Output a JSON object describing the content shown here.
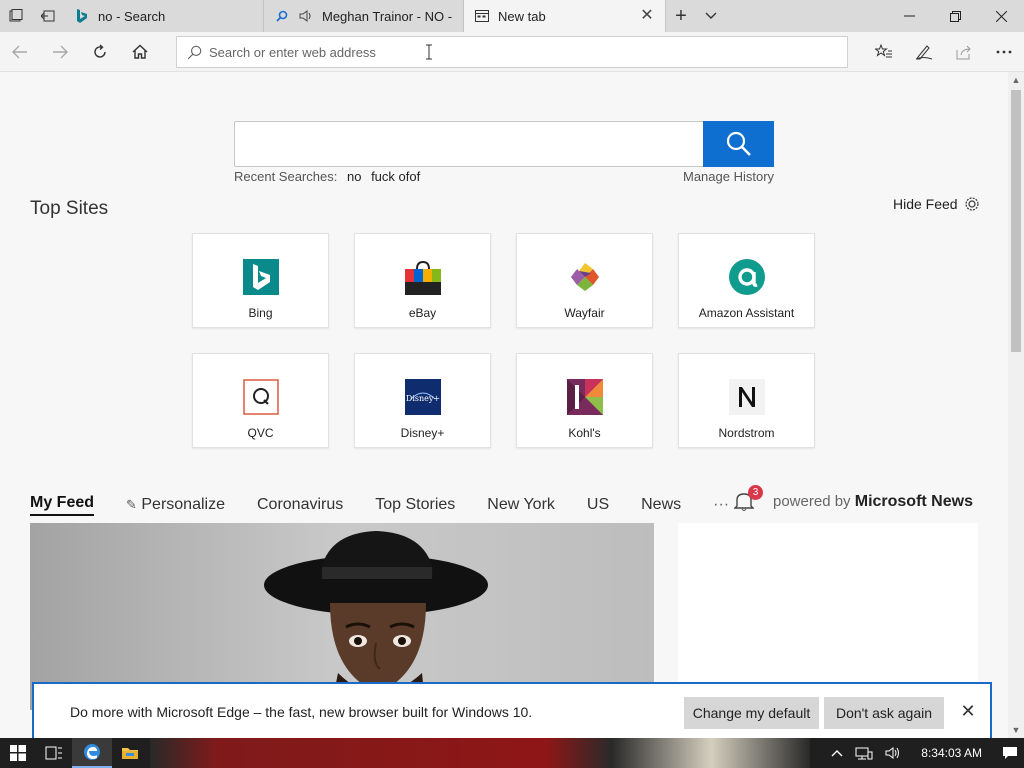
{
  "tabs": [
    {
      "label": "no - Search",
      "icon": "bing-icon"
    },
    {
      "label": "Meghan Trainor - NO -",
      "icon": "search-icon"
    },
    {
      "label": "New tab",
      "icon": "newtab-icon",
      "active": true
    }
  ],
  "toolbar": {
    "address_placeholder": "Search or enter web address"
  },
  "search": {
    "recent_label": "Recent Searches:",
    "recent_items": [
      "no",
      "fuck ofof"
    ],
    "manage_label": "Manage History"
  },
  "top_sites": {
    "title": "Top Sites",
    "hide_feed_label": "Hide Feed",
    "sites": [
      {
        "label": "Bing"
      },
      {
        "label": "eBay"
      },
      {
        "label": "Wayfair"
      },
      {
        "label": "Amazon Assistant"
      },
      {
        "label": "QVC"
      },
      {
        "label": "Disney+"
      },
      {
        "label": "Kohl's"
      },
      {
        "label": "Nordstrom"
      }
    ]
  },
  "feed": {
    "tabs": [
      "My Feed",
      "Personalize",
      "Coronavirus",
      "Top Stories",
      "New York",
      "US",
      "News"
    ],
    "more": "···",
    "notification_count": "3",
    "powered_by_prefix": "powered by",
    "powered_by_brand": "Microsoft News"
  },
  "notification": {
    "message": "Do more with Microsoft Edge – the fast, new browser built for Windows 10.",
    "change_default": "Change my default",
    "dont_ask": "Don't ask again"
  },
  "taskbar": {
    "clock": "8:34:03 AM"
  },
  "colors": {
    "accent": "#0f6fd1",
    "badge": "#d9384a",
    "notify_border": "#1b6ac9"
  }
}
